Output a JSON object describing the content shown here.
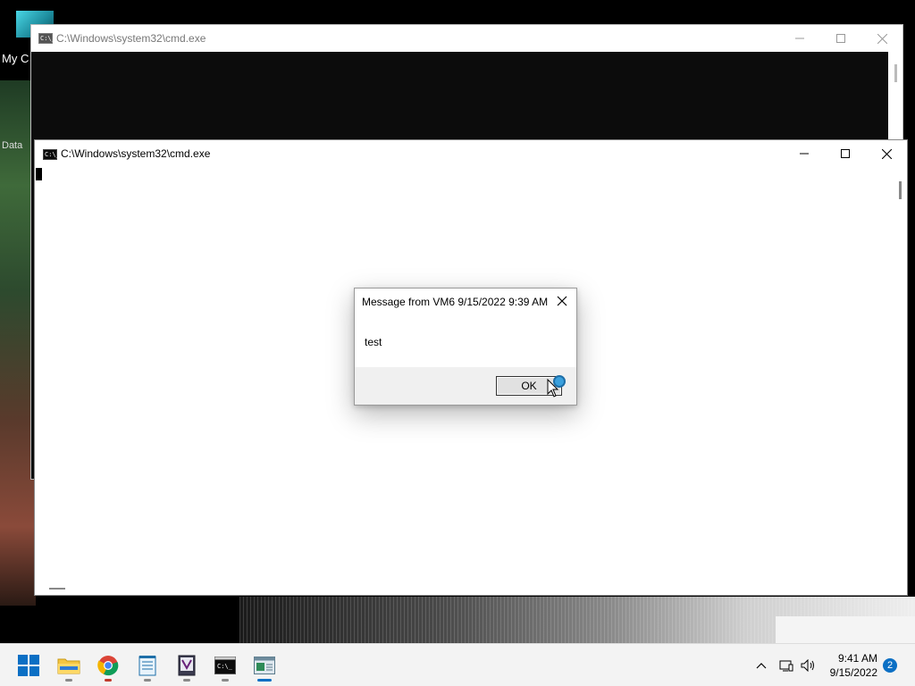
{
  "desktop": {
    "label_top": "My C",
    "label_bottom": "Data"
  },
  "back_window": {
    "title": "C:\\Windows\\system32\\cmd.exe",
    "icon_text": "C:\\_"
  },
  "front_window": {
    "title": "C:\\Windows\\system32\\cmd.exe",
    "icon_text": "C:\\_"
  },
  "message_box": {
    "title": "Message from VM6 9/15/2022 9:39 AM",
    "body": "test",
    "ok_label": "OK"
  },
  "taskbar": {
    "apps": [
      {
        "name": "start-button",
        "icon": "windows-logo-icon"
      },
      {
        "name": "file-explorer",
        "icon": "folder-icon"
      },
      {
        "name": "chrome",
        "icon": "chrome-icon"
      },
      {
        "name": "notepad",
        "icon": "notepad-icon"
      },
      {
        "name": "visual-studio",
        "icon": "visual-studio-icon"
      },
      {
        "name": "command-prompt",
        "icon": "terminal-icon"
      },
      {
        "name": "message-app",
        "icon": "message-window-icon"
      }
    ],
    "clock_time": "9:41 AM",
    "clock_date": "9/15/2022",
    "notification_count": "2"
  },
  "colors": {
    "accent": "#0b6fc4",
    "console_black": "#0c0c0c",
    "taskbar": "#f3f3f3"
  }
}
